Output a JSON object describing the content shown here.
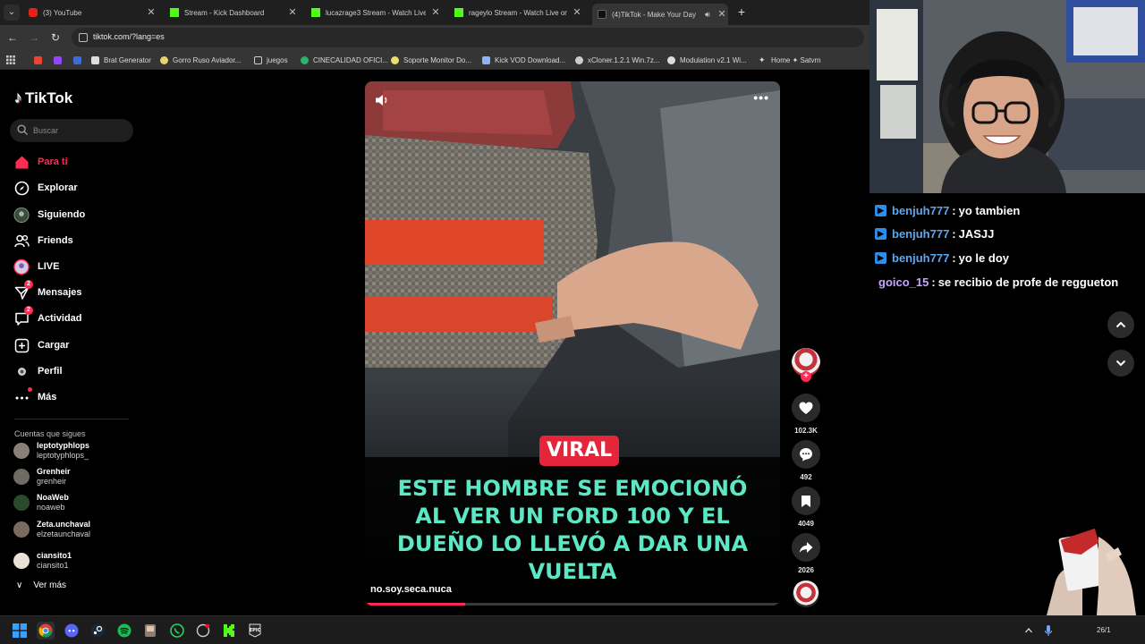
{
  "browser": {
    "tabs": [
      {
        "label": "(3) YouTube",
        "favicon": "youtube-icon"
      },
      {
        "label": "Stream - Kick Dashboard",
        "favicon": "kick-icon"
      },
      {
        "label": "lucazrage3 Stream - Watch Live",
        "favicon": "kick-icon"
      },
      {
        "label": "rageylo Stream - Watch Live on",
        "favicon": "kick-icon"
      },
      {
        "label": "(4)TikTok - Make Your Day",
        "favicon": "tiktok-icon",
        "active": true
      }
    ],
    "url": "tiktok.com/?lang=es",
    "bookmarks": [
      "Brat Generator",
      "Gorro Ruso Aviador...",
      "juegos",
      "CINECALIDAD OFICI...",
      "Soporte Monitor Do...",
      "Kick VOD Download...",
      "xCloner.1.2.1 Win.7z...",
      "Modulation v2.1 Wi...",
      "Home ✦ Satvrn"
    ]
  },
  "tiktok": {
    "logo": "TikTok",
    "search_placeholder": "Buscar",
    "nav": [
      {
        "label": "Para ti",
        "icon": "home-icon"
      },
      {
        "label": "Explorar",
        "icon": "compass-icon"
      },
      {
        "label": "Siguiendo",
        "icon": "following-avatar-icon"
      },
      {
        "label": "Friends",
        "icon": "friends-icon"
      },
      {
        "label": "LIVE",
        "icon": "live-icon"
      },
      {
        "label": "Mensajes",
        "icon": "messages-icon",
        "badge": "2"
      },
      {
        "label": "Actividad",
        "icon": "activity-icon",
        "badge": "2"
      },
      {
        "label": "Cargar",
        "icon": "upload-icon"
      },
      {
        "label": "Perfil",
        "icon": "profile-icon"
      },
      {
        "label": "Más",
        "icon": "more-icon"
      }
    ],
    "following_title": "Cuentas que sigues",
    "following": [
      {
        "name": "leptotyphlops",
        "handle": "leptotyphlops_",
        "color": "#8a7f76"
      },
      {
        "name": "Grenheir",
        "handle": "grenheir",
        "color": "#6f6a64"
      },
      {
        "name": "NoaWeb",
        "handle": "noaweb",
        "color": "#2a4a2a"
      },
      {
        "name": "Zeta.unchaval",
        "handle": "elzetaunchaval",
        "color": "#7b6a5e"
      },
      {
        "name": "ciansito1",
        "handle": "ciansito1",
        "color": "#e8e2d8"
      }
    ],
    "see_more": "Ver más",
    "video": {
      "badge": "VIRAL",
      "caption": "ESTE HOMBRE SE EMOCIONÓ AL VER UN FORD 100 Y EL DUEÑO LO LLEVÓ A DAR UNA VUELTA",
      "author": "no.soy.seca.nuca",
      "progress": 0.24,
      "likes": "102.3K",
      "comments": "492",
      "saves": "4049",
      "shares": "2026"
    }
  },
  "chat": [
    {
      "user": "benjuh777",
      "sep": ":",
      "text": "yo tambien",
      "badge": true
    },
    {
      "user": "benjuh777",
      "sep": ":",
      "text": "JASJJ",
      "badge": true
    },
    {
      "user": "benjuh777",
      "sep": ":",
      "text": "yo le doy",
      "badge": true
    },
    {
      "user": "goico_15",
      "sep": ":",
      "text": "se recibio de profe de reggueton",
      "badge": false
    }
  ],
  "taskbar": {
    "date": "26/1"
  },
  "colors": {
    "tiktok_red": "#fe2c55",
    "caption_teal": "#5ce7c5",
    "kick_green": "#53fc18",
    "chat_blue": "#5ca6f0"
  }
}
